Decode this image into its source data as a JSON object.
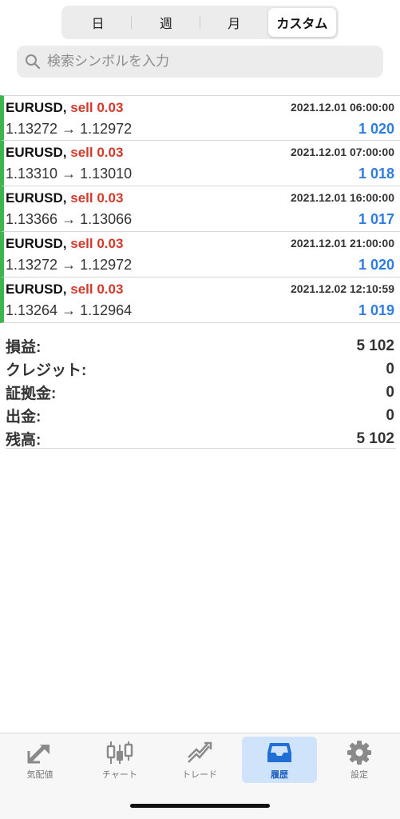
{
  "segments": {
    "day": "日",
    "week": "週",
    "month": "月",
    "custom": "カスタム"
  },
  "search": {
    "placeholder": "検索シンボルを入力"
  },
  "trades": [
    {
      "symbol": "EURUSD,",
      "side": "sell 0.03",
      "time": "2021.12.01 06:00:00",
      "prices": "1.13272 → 1.12972",
      "profit": "1 020"
    },
    {
      "symbol": "EURUSD,",
      "side": "sell 0.03",
      "time": "2021.12.01 07:00:00",
      "prices": "1.13310 → 1.13010",
      "profit": "1 018"
    },
    {
      "symbol": "EURUSD,",
      "side": "sell 0.03",
      "time": "2021.12.01 16:00:00",
      "prices": "1.13366 → 1.13066",
      "profit": "1 017"
    },
    {
      "symbol": "EURUSD,",
      "side": "sell 0.03",
      "time": "2021.12.01 21:00:00",
      "prices": "1.13272 → 1.12972",
      "profit": "1 020"
    },
    {
      "symbol": "EURUSD,",
      "side": "sell 0.03",
      "time": "2021.12.02 12:10:59",
      "prices": "1.13264 → 1.12964",
      "profit": "1 019"
    }
  ],
  "summary": [
    {
      "label": "損益:",
      "value": "5 102"
    },
    {
      "label": "クレジット:",
      "value": "0"
    },
    {
      "label": "証拠金:",
      "value": "0"
    },
    {
      "label": "出金:",
      "value": "0"
    },
    {
      "label": "残高:",
      "value": "5 102"
    }
  ],
  "tabs": [
    {
      "label": "気配値",
      "icon": "quotes-icon"
    },
    {
      "label": "チャート",
      "icon": "candlestick-icon"
    },
    {
      "label": "トレード",
      "icon": "trade-icon"
    },
    {
      "label": "履歴",
      "icon": "inbox-icon"
    },
    {
      "label": "設定",
      "icon": "gear-icon"
    }
  ],
  "colors": {
    "sell": "#d23a2c",
    "profit": "#2f7de1",
    "row_marker": "#3fb34f",
    "active_tab_bg": "#cfe3fb"
  }
}
